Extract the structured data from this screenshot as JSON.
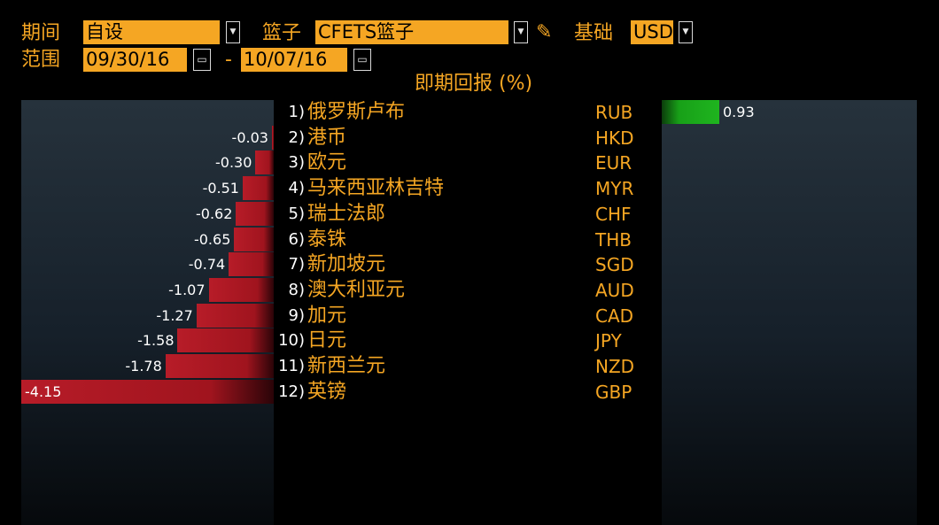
{
  "header": {
    "period_label": "期间",
    "period_value": "自设",
    "basket_label": "篮子",
    "basket_value": "CFETS篮子",
    "base_label": "基础",
    "base_value": "USD",
    "range_label": "范围",
    "start_date": "09/30/16",
    "date_separator": "-",
    "end_date": "10/07/16"
  },
  "colors": {
    "accent": "#f5a623",
    "negative": "#b71c28",
    "positive": "#1fb51f",
    "background": "#000000",
    "panel": "#1c2630"
  },
  "chart_data": {
    "type": "bar",
    "title": "即期回报 (%)",
    "orientation": "horizontal-diverging",
    "xlim": [
      -4.15,
      0.93
    ],
    "categories": [
      {
        "rank": "1)",
        "name": "俄罗斯卢布",
        "code": "RUB"
      },
      {
        "rank": "2)",
        "name": "港币",
        "code": "HKD"
      },
      {
        "rank": "3)",
        "name": "欧元",
        "code": "EUR"
      },
      {
        "rank": "4)",
        "name": "马来西亚林吉特",
        "code": "MYR"
      },
      {
        "rank": "5)",
        "name": "瑞士法郎",
        "code": "CHF"
      },
      {
        "rank": "6)",
        "name": "泰铢",
        "code": "THB"
      },
      {
        "rank": "7)",
        "name": "新加坡元",
        "code": "SGD"
      },
      {
        "rank": "8)",
        "name": "澳大利亚元",
        "code": "AUD"
      },
      {
        "rank": "9)",
        "name": "加元",
        "code": "CAD"
      },
      {
        "rank": "10)",
        "name": "日元",
        "code": "JPY"
      },
      {
        "rank": "11)",
        "name": "新西兰元",
        "code": "NZD"
      },
      {
        "rank": "12)",
        "name": "英镑",
        "code": "GBP"
      }
    ],
    "values": [
      0.93,
      -0.03,
      -0.3,
      -0.51,
      -0.62,
      -0.65,
      -0.74,
      -1.07,
      -1.27,
      -1.58,
      -1.78,
      -4.15
    ],
    "value_labels": [
      "0.93",
      "-0.03",
      "-0.30",
      "-0.51",
      "-0.62",
      "-0.65",
      "-0.74",
      "-1.07",
      "-1.27",
      "-1.58",
      "-1.78",
      "-4.15"
    ]
  }
}
